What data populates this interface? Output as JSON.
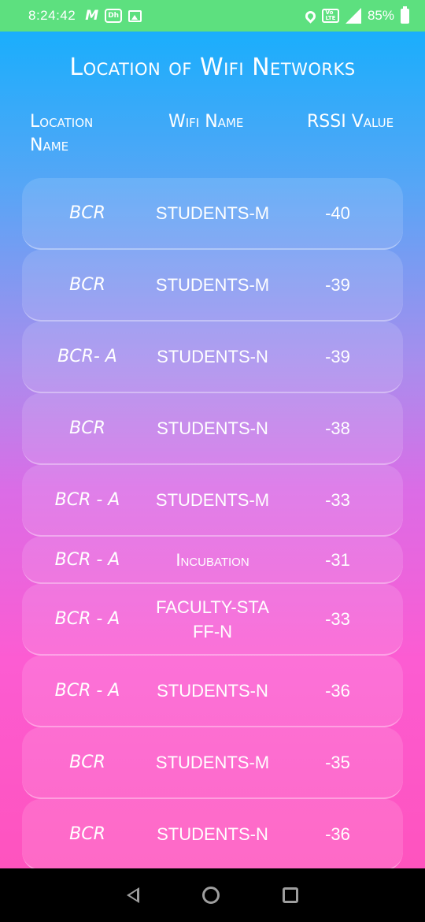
{
  "status_bar": {
    "time": "8:24:42",
    "battery_pct": "85%",
    "network": "4G"
  },
  "page": {
    "title": "Location of Wifi Networks",
    "headers": {
      "location": "Location Name",
      "wifi": "Wifi Name",
      "rssi": "RSSI Value"
    }
  },
  "rows": [
    {
      "location": "BCR",
      "wifi": "STUDENTS-M",
      "rssi": "-40"
    },
    {
      "location": "BCR",
      "wifi": "STUDENTS-M",
      "rssi": "-39"
    },
    {
      "location": "BCR- A",
      "wifi": "STUDENTS-N",
      "rssi": "-39"
    },
    {
      "location": "BCR",
      "wifi": "STUDENTS-N",
      "rssi": "-38"
    },
    {
      "location": "BCR - A",
      "wifi": "STUDENTS-M",
      "rssi": "-33"
    },
    {
      "location": "BCR - A",
      "wifi": "Incubation",
      "rssi": "-31"
    },
    {
      "location": "BCR - A",
      "wifi": "FACULTY-STAFF-N",
      "rssi": "-33"
    },
    {
      "location": "BCR - A",
      "wifi": "STUDENTS-N",
      "rssi": "-36"
    },
    {
      "location": "BCR",
      "wifi": "STUDENTS-M",
      "rssi": "-35"
    },
    {
      "location": "BCR",
      "wifi": "STUDENTS-N",
      "rssi": "-36"
    }
  ],
  "colors": {
    "status_bar": "#5de07f",
    "gradient_top": "#1aaefc",
    "gradient_bottom": "#fe53be"
  }
}
